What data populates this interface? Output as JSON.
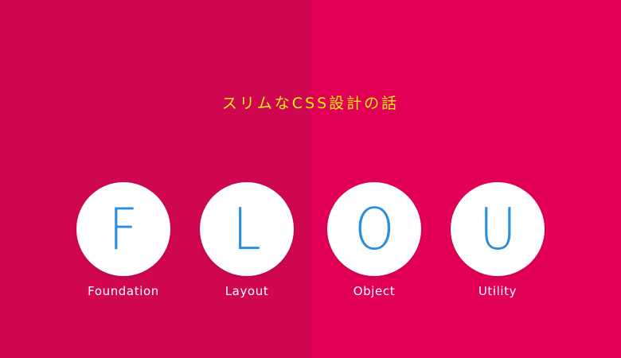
{
  "title": "スリムなCSS設計の話",
  "colors": {
    "background_left": "#cf0751",
    "background_right": "#e10055",
    "title": "#f4f20f",
    "circle": "#ffffff",
    "letter": "#2b8fe0",
    "label": "#ffffff"
  },
  "items": [
    {
      "letter": "F",
      "label": "Foundation"
    },
    {
      "letter": "L",
      "label": "Layout"
    },
    {
      "letter": "O",
      "label": "Object"
    },
    {
      "letter": "U",
      "label": "Utility"
    }
  ]
}
